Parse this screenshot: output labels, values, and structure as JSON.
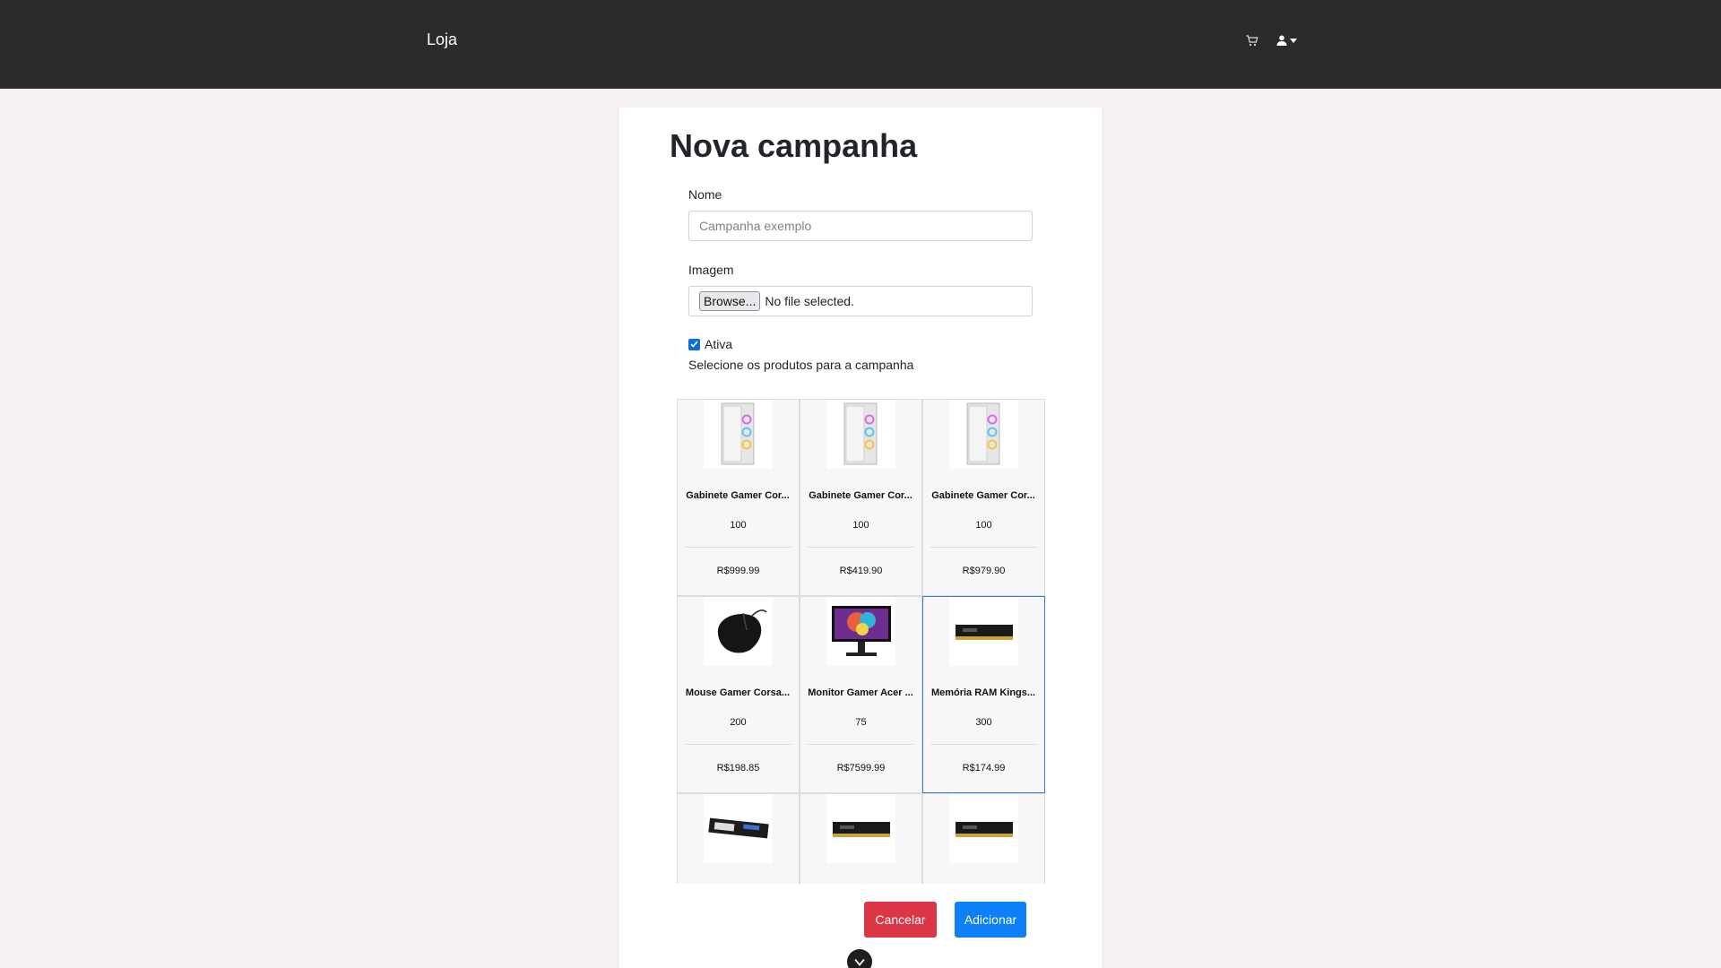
{
  "navbar": {
    "brand": "Loja",
    "cart_icon": "cart-icon",
    "user_icon": "user-icon"
  },
  "form": {
    "title": "Nova campanha",
    "name_label": "Nome",
    "name_placeholder": "Campanha exemplo",
    "name_value": "",
    "image_label": "Imagem",
    "browse_label": "Browse...",
    "file_status": "No file selected.",
    "active_label": "Ativa",
    "active_checked": true,
    "select_hint": "Selecione os produtos para a campanha"
  },
  "products": [
    {
      "name": "Gabinete Gamer Cor...",
      "qty": "100",
      "price": "R$999.99",
      "image": "pc-case-image",
      "selected": false
    },
    {
      "name": "Gabinete Gamer Cor...",
      "qty": "100",
      "price": "R$419.90",
      "image": "pc-case-image",
      "selected": false
    },
    {
      "name": "Gabinete Gamer Cor...",
      "qty": "100",
      "price": "R$979.90",
      "image": "pc-case-image",
      "selected": false
    },
    {
      "name": "Mouse Gamer Corsa...",
      "qty": "200",
      "price": "R$198.85",
      "image": "mouse-image",
      "selected": false
    },
    {
      "name": "Monitor Gamer Acer ...",
      "qty": "75",
      "price": "R$7599.99",
      "image": "monitor-image",
      "selected": false
    },
    {
      "name": "Memória RAM Kings...",
      "qty": "300",
      "price": "R$174.99",
      "image": "ram-image",
      "selected": true
    },
    {
      "name": "",
      "qty": "",
      "price": "",
      "image": "ssd-image",
      "selected": false
    },
    {
      "name": "",
      "qty": "",
      "price": "",
      "image": "ram-image",
      "selected": false
    },
    {
      "name": "",
      "qty": "",
      "price": "",
      "image": "ram-image",
      "selected": false
    }
  ],
  "actions": {
    "cancel_label": "Cancelar",
    "add_label": "Adicionar"
  },
  "colors": {
    "navbar": "#2b2b2b",
    "cancel": "#dc3545",
    "add": "#0d7ff7",
    "selected_border": "#2f7fd6"
  }
}
